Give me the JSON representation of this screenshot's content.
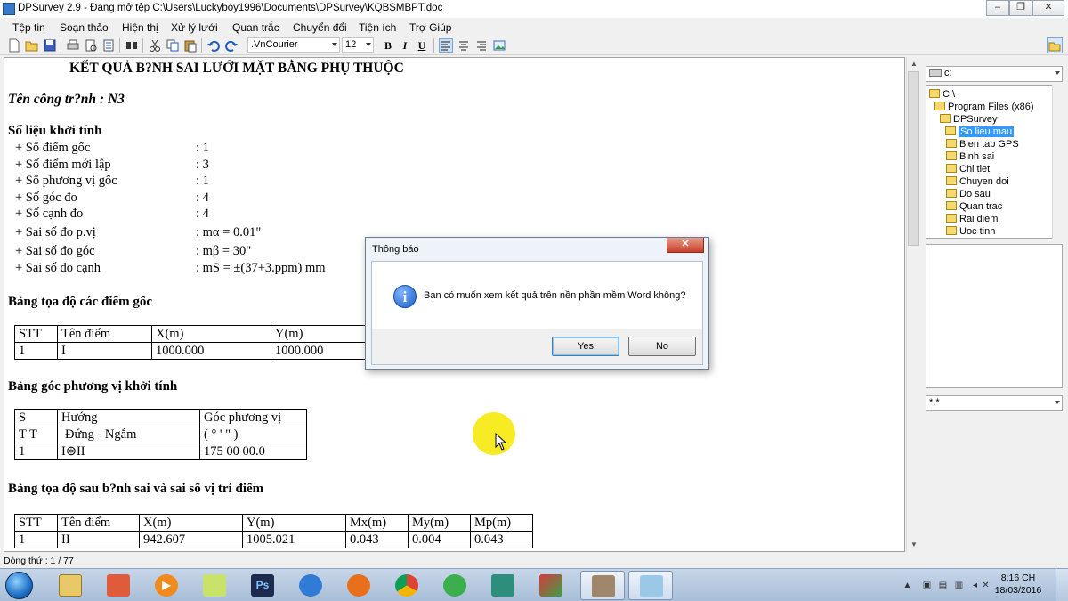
{
  "window": {
    "title": "DPSurvey 2.9 - Đang mở tệp C:\\Users\\Luckyboy1996\\Documents\\DPSurvey\\KQBSMBPT.doc",
    "min_glyph": "–",
    "max_glyph": "❐",
    "close_glyph": "✕"
  },
  "menu": [
    "Tệp tin",
    "Soạn thảo",
    "Hiện thị",
    "Xử lý lưới",
    "Quan trắc",
    "Chuyển đổi",
    "Tiện ích",
    "Trợ Giúp"
  ],
  "toolbar": {
    "font": ".VnCourier",
    "size": "12",
    "bold": "B",
    "italic": "I",
    "underline": "U",
    "icons": [
      "new-file-icon",
      "open-folder-icon",
      "save-icon",
      "print-icon",
      "print-preview-icon",
      "page-icon",
      "page-copy-icon",
      "find-icon",
      "cut-icon",
      "copy-icon",
      "paste-icon",
      "undo-icon",
      "redo-icon",
      "align-left-icon",
      "align-center-icon",
      "align-right-icon",
      "insert-image-icon"
    ]
  },
  "document": {
    "title": "KẾT QUẢ B?NH SAI LƯỚI MẶT BẰNG PHỤ THUỘC",
    "project": "Tên công tr?nh :  N3",
    "start_heading": "Số liệu khởi tính",
    "start_items": [
      {
        "label": "+ Số điểm gốc",
        "value": ": 1"
      },
      {
        "label": "+ Số điểm mới lập",
        "value": ": 3"
      },
      {
        "label": "+ Số phương vị gốc",
        "value": ": 1"
      },
      {
        "label": "+ Số góc đo",
        "value": ": 4"
      },
      {
        "label": "+ Số cạnh đo",
        "value": ": 4"
      },
      {
        "label": "+ Sai số đo p.vị",
        "value": ": mα = 0.01\""
      },
      {
        "label": "+ Sai số đo góc",
        "value": ": mβ = 30\""
      },
      {
        "label": "+ Sai số đo cạnh",
        "value": ": mS = ±(37+3.ppm) mm"
      }
    ],
    "table1_heading": "Bảng tọa độ các điểm gốc",
    "table1": {
      "headers": [
        "STT",
        "Tên điểm",
        "X(m)",
        "Y(m)"
      ],
      "rows": [
        [
          "1",
          "I",
          "1000.000",
          "1000.000"
        ]
      ]
    },
    "table2_heading": "Bảng góc phương vị khởi tính",
    "table2": {
      "headers": [
        "S",
        "Hướng",
        "Góc phương vị"
      ],
      "subheaders": [
        "T T",
        "Đứng - Ngắm",
        "( °   '    \" )"
      ],
      "rows": [
        [
          "1",
          "I⊛II",
          "175 00 00.0"
        ]
      ]
    },
    "table3_heading": "Bảng tọa độ sau b?nh sai và sai số vị trí điểm",
    "table3": {
      "headers": [
        "STT",
        "Tên điểm",
        "X(m)",
        "Y(m)",
        "Mx(m)",
        "My(m)",
        "Mp(m)"
      ],
      "rows": [
        [
          "1",
          "II",
          "942.607",
          "1005.021",
          "0.043",
          "0.004",
          "0.043"
        ]
      ]
    }
  },
  "explorer": {
    "drive": "c:",
    "tree": [
      "C:\\",
      "Program Files (x86)",
      "DPSurvey",
      "So lieu mau",
      "Bien tap GPS",
      "Binh sai",
      "Chi tiet",
      "Chuyen doi",
      "Do sau",
      "Quan trac",
      "Rai diem",
      "Uoc tinh"
    ],
    "selected": "So lieu mau",
    "filter": "*.*"
  },
  "status": {
    "line": "Dòng thứ : 1 / 77"
  },
  "dialog": {
    "title": "Thông báo",
    "message": "Bạn có muốn xem kết quả trên nền phần mềm Word không?",
    "yes": "Yes",
    "no": "No",
    "close_glyph": "✕",
    "icon_glyph": "i"
  },
  "taskbar": {
    "apps": [
      "windows-explorer-icon",
      "network-icon",
      "media-player-icon",
      "sticky-notes-icon",
      "photoshop-icon",
      "internet-explorer-icon",
      "firefox-icon",
      "chrome-icon",
      "coccoc-icon",
      "autocad-icon",
      "winrar-icon",
      "dpsurvey-icon",
      "notepad-icon"
    ],
    "ps_label": "Ps",
    "time": "8:16 CH",
    "date": "18/03/2016"
  },
  "colors": {
    "selection": "#3399ff",
    "cursor_highlight": "#f7ec24",
    "dialog_close": "#c8402a"
  }
}
